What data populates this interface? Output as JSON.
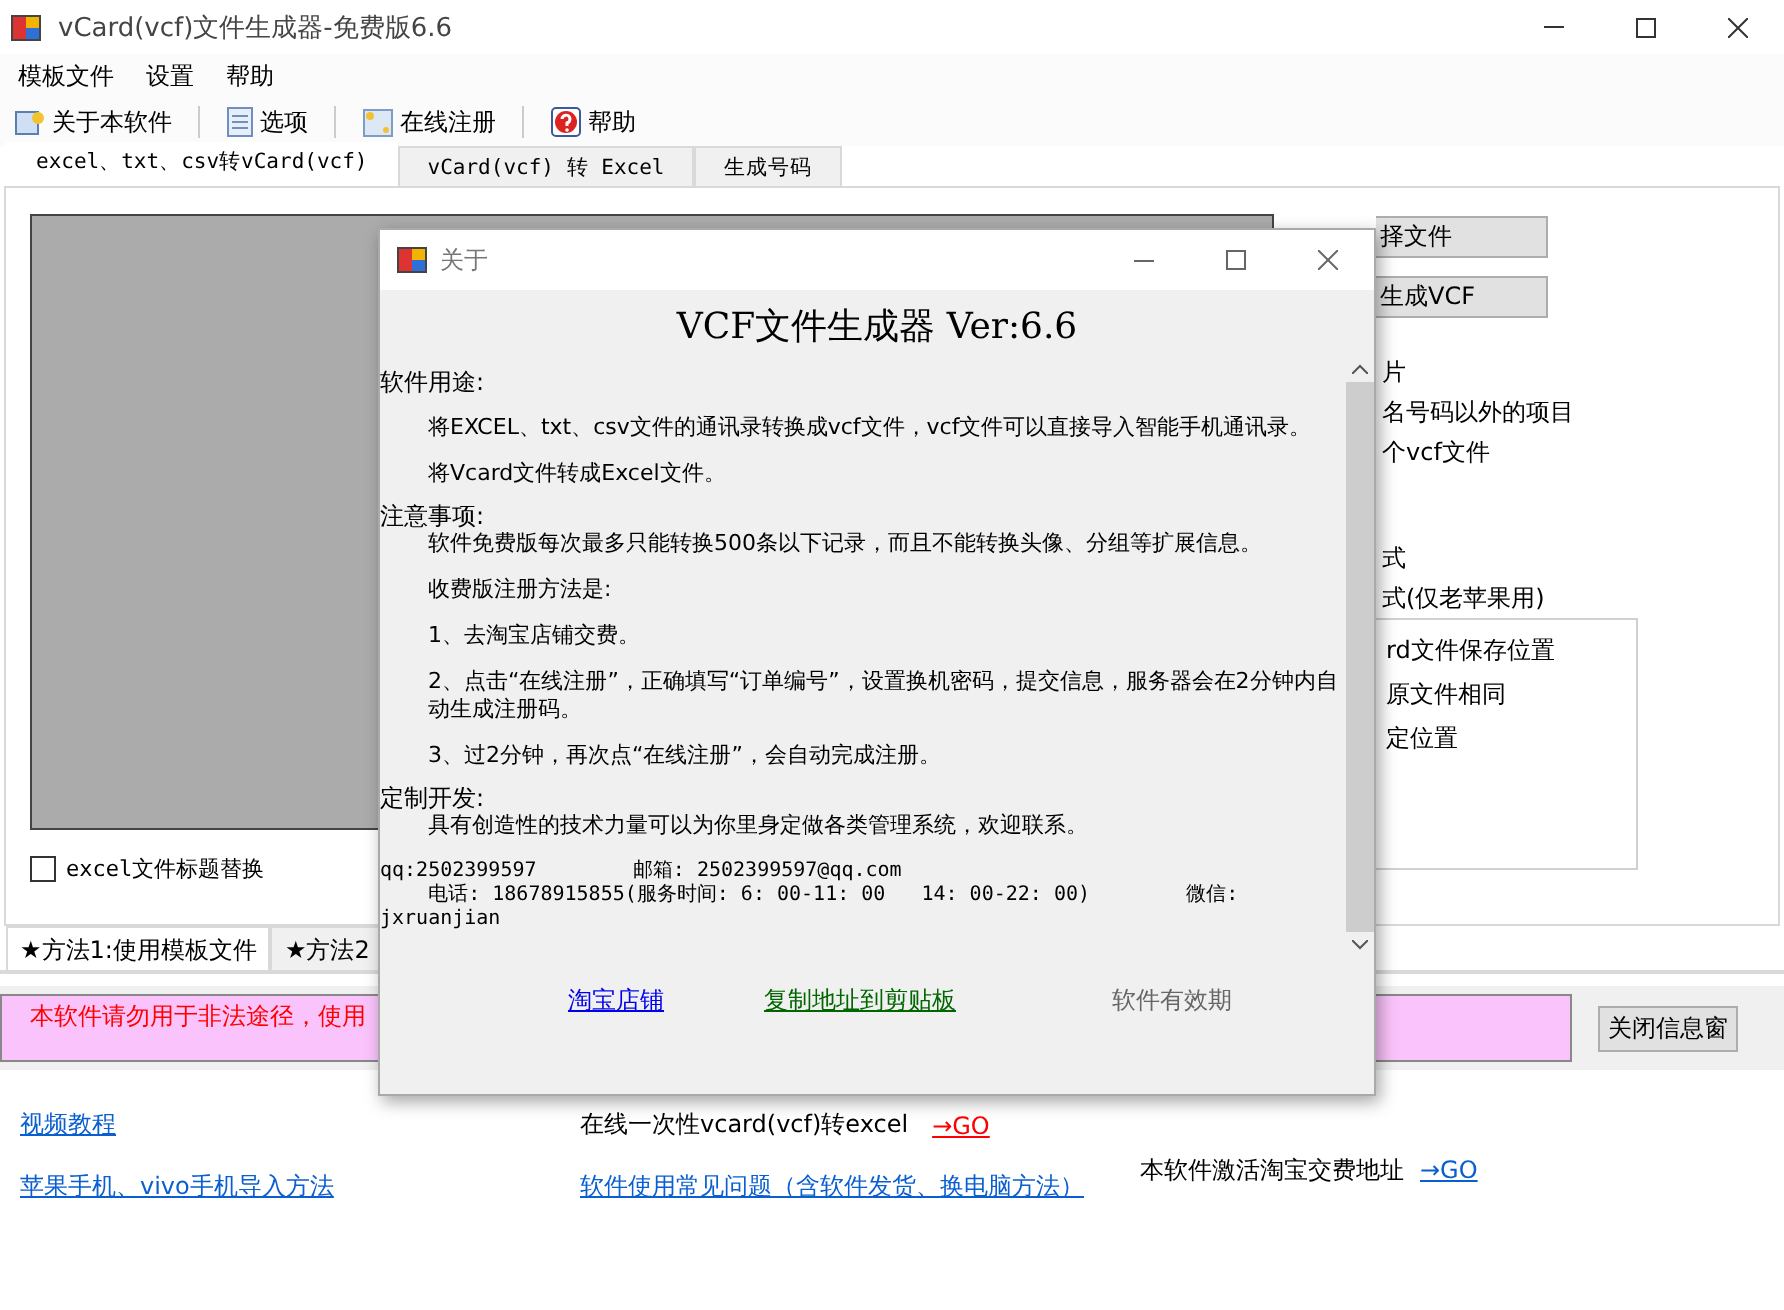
{
  "window": {
    "title": "vCard(vcf)文件生成器-免费版6.6"
  },
  "menu": [
    "模板文件",
    "设置",
    "帮助"
  ],
  "toolbar": [
    {
      "label": "关于本软件",
      "kind": "about"
    },
    {
      "label": "选项",
      "kind": "options"
    },
    {
      "label": "在线注册",
      "kind": "register"
    },
    {
      "label": "帮助",
      "kind": "help"
    }
  ],
  "tabs": [
    {
      "label": "excel、txt、csv转vCard(vcf)",
      "selected": true
    },
    {
      "label": "vCard(vcf) 转 Excel",
      "selected": false
    },
    {
      "label": "生成号码",
      "selected": false
    }
  ],
  "panel": {
    "checkbox": {
      "label": "excel文件标题替换",
      "checked": false
    },
    "buttons": [
      "择文件",
      "生成VCF"
    ],
    "options": [
      "片",
      "名号码以外的项目",
      "个vcf文件"
    ],
    "formats": [
      "式",
      "式(仅老苹果用)"
    ],
    "group": {
      "title": "rd文件保存位置",
      "items": [
        "原文件相同",
        "定位置"
      ]
    }
  },
  "method_tabs": [
    {
      "label": "★方法1:使用模板文件",
      "selected": true
    },
    {
      "label": "★方法2",
      "selected": false
    }
  ],
  "notice": {
    "text": "本软件请勿用于非法途径，使用",
    "button": "关闭信息窗"
  },
  "links": {
    "video": "视频教程",
    "import": "苹果手机、vivo手机导入方法",
    "online_text": "在线一次性vcard(vcf)转excel",
    "online_go": "→GO",
    "faq": "软件使用常见问题（含软件发货、换电脑方法）",
    "activate_text": "本软件激活淘宝交费地址",
    "activate_go": "→GO"
  },
  "dialog": {
    "title": "关于",
    "heading": "VCF文件生成器 Ver:6.6",
    "blocks": [
      {
        "kind": "section",
        "text": "软件用途:"
      },
      {
        "kind": "para",
        "text": "将EXCEL、txt、csv文件的通讯录转换成vcf文件，vcf文件可以直接导入智能手机通讯录。"
      },
      {
        "kind": "para",
        "text": "将Vcard文件转成Excel文件。"
      },
      {
        "kind": "section",
        "text": "注意事项:"
      },
      {
        "kind": "item",
        "text": "软件免费版每次最多只能转换500条以下记录，而且不能转换头像、分组等扩展信息。"
      },
      {
        "kind": "para",
        "text": "收费版注册方法是:"
      },
      {
        "kind": "para",
        "text": "1、去淘宝店铺交费。"
      },
      {
        "kind": "para",
        "text": "2、点击“在线注册”，正确填写“订单编号”，设置换机密码，提交信息，服务器会在2分钟内自动生成注册码。"
      },
      {
        "kind": "para",
        "text": "3、过2分钟，再次点“在线注册”，会自动完成注册。"
      },
      {
        "kind": "section",
        "text": "定制开发:"
      },
      {
        "kind": "item",
        "text": "具有创造性的技术力量可以为你里身定做各类管理系统，欢迎联系。"
      },
      {
        "kind": "contact",
        "text": "qq:2502399597        邮箱: 2502399597@qq.com\n    电话: 18678915855(服务时间: 6: 00-11: 00   14: 00-22: 00)        微信:\njxruanjian"
      }
    ],
    "links": [
      {
        "label": "淘宝店铺",
        "kind": "link"
      },
      {
        "label": "复制地址到剪贴板",
        "kind": "copy"
      },
      {
        "label": "软件有效期",
        "kind": "plain"
      }
    ]
  }
}
